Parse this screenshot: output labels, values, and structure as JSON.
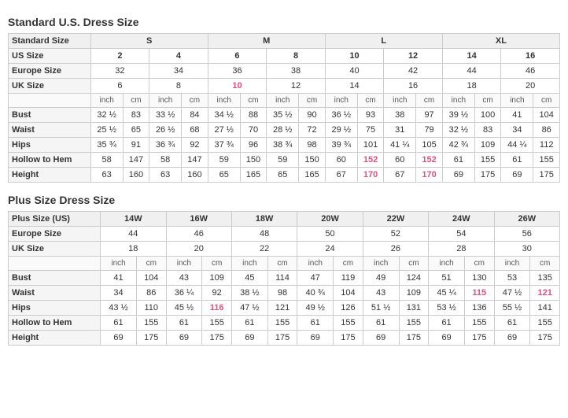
{
  "standard": {
    "title": "Standard U.S. Dress Size",
    "size_groups": [
      "S",
      "M",
      "L",
      "XL"
    ],
    "us_sizes": [
      "2",
      "4",
      "6",
      "8",
      "10",
      "12",
      "14",
      "16"
    ],
    "europe_sizes": [
      "32",
      "34",
      "36",
      "38",
      "40",
      "42",
      "44",
      "46"
    ],
    "uk_sizes": [
      "6",
      "8",
      "10",
      "12",
      "14",
      "16",
      "18",
      "20"
    ],
    "uk_highlights": [
      2
    ],
    "measurements": [
      {
        "label": "Bust",
        "values": [
          "32 ½",
          "83",
          "33 ½",
          "84",
          "34 ½",
          "88",
          "35 ½",
          "90",
          "36 ½",
          "93",
          "38",
          "97",
          "39 ½",
          "100",
          "41",
          "104"
        ]
      },
      {
        "label": "Waist",
        "values": [
          "25 ½",
          "65",
          "26 ½",
          "68",
          "27 ½",
          "70",
          "28 ½",
          "72",
          "29 ½",
          "75",
          "31",
          "79",
          "32 ½",
          "83",
          "34",
          "86"
        ]
      },
      {
        "label": "Hips",
        "values": [
          "35 ¾",
          "91",
          "36 ¾",
          "92",
          "37 ¾",
          "96",
          "38 ¾",
          "98",
          "39 ¾",
          "101",
          "41 ¼",
          "105",
          "42 ¾",
          "109",
          "44 ¼",
          "112"
        ]
      },
      {
        "label": "Hollow to Hem",
        "values": [
          "58",
          "147",
          "58",
          "147",
          "59",
          "150",
          "59",
          "150",
          "60",
          "152",
          "60",
          "152",
          "61",
          "155",
          "61",
          "155"
        ]
      },
      {
        "label": "Height",
        "values": [
          "63",
          "160",
          "63",
          "160",
          "65",
          "165",
          "65",
          "165",
          "67",
          "170",
          "67",
          "170",
          "69",
          "175",
          "69",
          "175"
        ]
      }
    ],
    "hollow_highlights": [
      10,
      11
    ],
    "height_highlights": [
      10,
      11
    ]
  },
  "plus": {
    "title": "Plus Size Dress Size",
    "plus_sizes": [
      "14W",
      "16W",
      "18W",
      "20W",
      "22W",
      "24W",
      "26W"
    ],
    "europe_sizes": [
      "44",
      "46",
      "48",
      "50",
      "52",
      "54",
      "56"
    ],
    "uk_sizes": [
      "18",
      "20",
      "22",
      "24",
      "26",
      "28",
      "30"
    ],
    "measurements": [
      {
        "label": "Bust",
        "values": [
          "41",
          "104",
          "43",
          "109",
          "45",
          "114",
          "47",
          "119",
          "49",
          "124",
          "51",
          "130",
          "53",
          "135"
        ]
      },
      {
        "label": "Waist",
        "values": [
          "34",
          "86",
          "36 ¼",
          "92",
          "38 ½",
          "98",
          "40 ¾",
          "104",
          "43",
          "109",
          "45 ¼",
          "115",
          "47 ½",
          "121"
        ]
      },
      {
        "label": "Hips",
        "values": [
          "43 ½",
          "110",
          "45 ½",
          "116",
          "47 ½",
          "121",
          "49 ½",
          "126",
          "51 ½",
          "131",
          "53 ½",
          "136",
          "55 ½",
          "141"
        ]
      },
      {
        "label": "Hollow to Hem",
        "values": [
          "61",
          "155",
          "61",
          "155",
          "61",
          "155",
          "61",
          "155",
          "61",
          "155",
          "61",
          "155",
          "61",
          "155"
        ]
      },
      {
        "label": "Height",
        "values": [
          "69",
          "175",
          "69",
          "175",
          "69",
          "175",
          "69",
          "175",
          "69",
          "175",
          "69",
          "175",
          "69",
          "175"
        ]
      }
    ],
    "waist_highlights": [
      10,
      11,
      12,
      13
    ],
    "hips_highlights": [
      2,
      3,
      12,
      13
    ]
  }
}
